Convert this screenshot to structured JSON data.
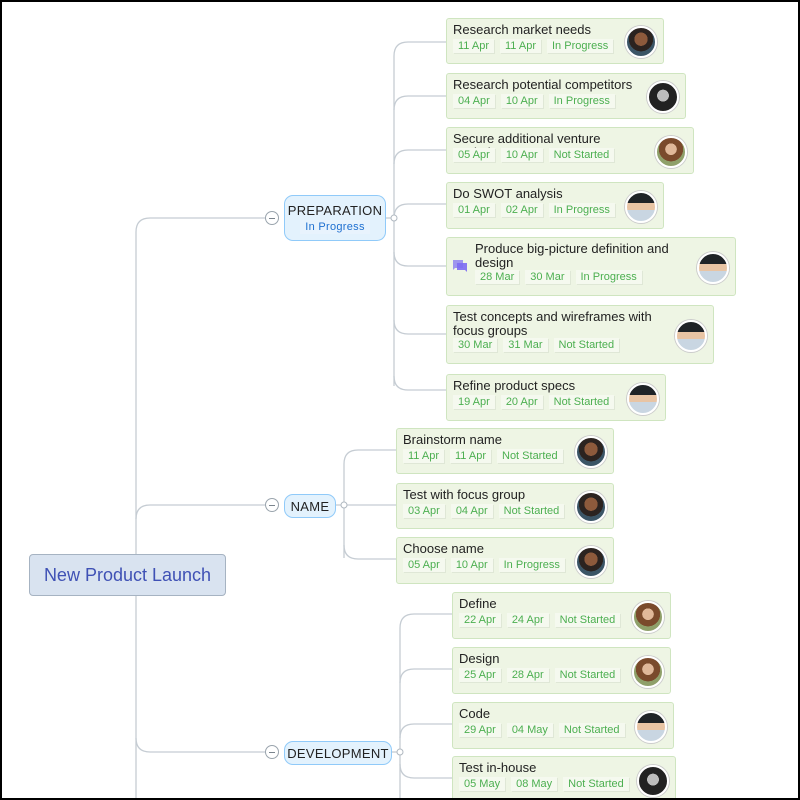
{
  "root": {
    "label": "New Product Launch"
  },
  "colors": {
    "done_text": "#4caf50",
    "branch_status": "#1e6fd0",
    "root_text": "#3f51b5",
    "comment_icon": "#7c6cf2"
  },
  "branches": [
    {
      "label": "PREPARATION",
      "status": "In Progress",
      "tasks": [
        {
          "title": "Research market needs",
          "start": "11 Apr",
          "end": "11 Apr",
          "status": "In Progress",
          "avatar": "person-curly-hair"
        },
        {
          "title": "Research potential competitors",
          "start": "04 Apr",
          "end": "10 Apr",
          "status": "In Progress",
          "avatar": "person-smiling-bw"
        },
        {
          "title": "Secure additional venture capital",
          "start": "05 Apr",
          "end": "10 Apr",
          "status": "Not Started",
          "avatar": "person-long-hair"
        },
        {
          "title": "Do SWOT analysis",
          "start": "01 Apr",
          "end": "02 Apr",
          "status": "In Progress",
          "avatar": "person-winter-hat"
        },
        {
          "title": "Produce big-picture definition and design",
          "start": "28 Mar",
          "end": "30 Mar",
          "status": "In Progress",
          "avatar": "person-winter-hat",
          "has_comment": true,
          "comment_icon": "comment-icon"
        },
        {
          "title": "Test concepts and wireframes with focus groups",
          "start": "30 Mar",
          "end": "31 Mar",
          "status": "Not Started",
          "avatar": "person-winter-hat"
        },
        {
          "title": "Refine product specs",
          "start": "19 Apr",
          "end": "20 Apr",
          "status": "Not Started",
          "avatar": "person-winter-hat"
        }
      ]
    },
    {
      "label": "NAME",
      "tasks": [
        {
          "title": "Brainstorm name",
          "start": "11 Apr",
          "end": "11 Apr",
          "status": "Not Started",
          "avatar": "person-curly-hair"
        },
        {
          "title": "Test with focus group",
          "start": "03 Apr",
          "end": "04 Apr",
          "status": "Not Started",
          "avatar": "person-curly-hair"
        },
        {
          "title": "Choose name",
          "start": "05 Apr",
          "end": "10 Apr",
          "status": "In Progress",
          "avatar": "person-curly-hair"
        }
      ]
    },
    {
      "label": "DEVELOPMENT",
      "tasks": [
        {
          "title": "Define",
          "start": "22 Apr",
          "end": "24 Apr",
          "status": "Not Started",
          "avatar": "person-long-hair"
        },
        {
          "title": "Design",
          "start": "25 Apr",
          "end": "28 Apr",
          "status": "Not Started",
          "avatar": "person-long-hair"
        },
        {
          "title": "Code",
          "start": "29 Apr",
          "end": "04 May",
          "status": "Not Started",
          "avatar": "person-winter-hat"
        },
        {
          "title": "Test in-house",
          "start": "05 May",
          "end": "08 May",
          "status": "Not Started",
          "avatar": "person-smiling-bw"
        }
      ]
    }
  ]
}
